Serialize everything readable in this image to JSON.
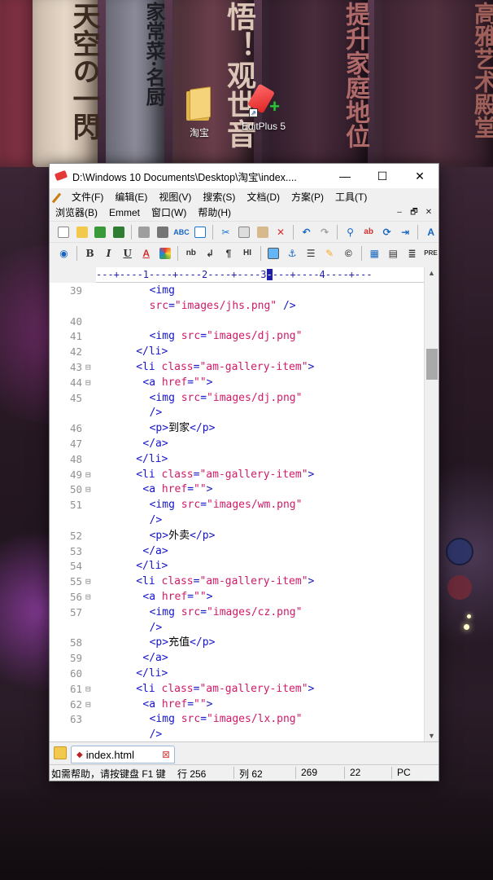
{
  "desktop": {
    "book_titles": [
      "天空の一閃",
      "家常菜·名厨",
      "悟！观世音",
      "提升家庭地位",
      "高雅艺术殿堂"
    ],
    "icons": [
      {
        "label": "淘宝",
        "icon": "folder-icon"
      },
      {
        "label": "EditPlus 5",
        "icon": "editplus-icon"
      }
    ]
  },
  "window": {
    "title": "D:\\Windows 10 Documents\\Desktop\\淘宝\\index....",
    "controls": {
      "minimize": "—",
      "maximize": "☐",
      "close": "✕"
    },
    "menu_row1": [
      "文件(F)",
      "编辑(E)",
      "视图(V)",
      "搜索(S)",
      "文档(D)",
      "方案(P)",
      "工具(T)"
    ],
    "menu_row2": [
      "浏览器(B)",
      "Emmet",
      "窗口(W)",
      "帮助(H)"
    ],
    "mdi_controls": [
      "–",
      "🗗",
      "✕"
    ],
    "ruler": "---+----1----+----2----+----3",
    "ruler_cursor": "-",
    "ruler_rest": "---+----4----+---"
  },
  "code_lines": [
    {
      "n": "39",
      "fold": "",
      "indent": 16,
      "parts": [
        [
          "tag",
          "<img"
        ]
      ]
    },
    {
      "n": "",
      "fold": "",
      "indent": 16,
      "parts": [
        [
          "attr",
          "src"
        ],
        [
          "tag",
          "="
        ],
        [
          "str",
          "\"images/jhs.png\""
        ],
        [
          "tag",
          " />"
        ]
      ]
    },
    {
      "n": "40",
      "fold": "",
      "indent": 0,
      "parts": []
    },
    {
      "n": "41",
      "fold": "",
      "indent": 16,
      "parts": [
        [
          "tag",
          "<img "
        ],
        [
          "attr",
          "src"
        ],
        [
          "tag",
          "="
        ],
        [
          "str",
          "\"images/dj.png\""
        ]
      ]
    },
    {
      "n": "42",
      "fold": "",
      "indent": 12,
      "parts": [
        [
          "tag",
          "</li>"
        ]
      ]
    },
    {
      "n": "43",
      "fold": "⊟",
      "indent": 12,
      "parts": [
        [
          "tag",
          "<li "
        ],
        [
          "attr",
          "class"
        ],
        [
          "tag",
          "="
        ],
        [
          "str",
          "\"am-gallery-item\""
        ],
        [
          "tag",
          ">"
        ]
      ]
    },
    {
      "n": "44",
      "fold": "⊟",
      "indent": 14,
      "parts": [
        [
          "tag",
          "<a "
        ],
        [
          "attr",
          "href"
        ],
        [
          "tag",
          "="
        ],
        [
          "str",
          "\"\""
        ],
        [
          "tag",
          ">"
        ]
      ]
    },
    {
      "n": "45",
      "fold": "",
      "indent": 16,
      "parts": [
        [
          "tag",
          "<img "
        ],
        [
          "attr",
          "src"
        ],
        [
          "tag",
          "="
        ],
        [
          "str",
          "\"images/dj.png\""
        ]
      ]
    },
    {
      "n": "",
      "fold": "",
      "indent": 16,
      "parts": [
        [
          "tag",
          "/>"
        ]
      ]
    },
    {
      "n": "46",
      "fold": "",
      "indent": 16,
      "parts": [
        [
          "tag",
          "<p>"
        ],
        [
          "txt",
          "到家"
        ],
        [
          "tag",
          "</p>"
        ]
      ]
    },
    {
      "n": "47",
      "fold": "",
      "indent": 14,
      "parts": [
        [
          "tag",
          "</a>"
        ]
      ]
    },
    {
      "n": "48",
      "fold": "",
      "indent": 12,
      "parts": [
        [
          "tag",
          "</li>"
        ]
      ]
    },
    {
      "n": "49",
      "fold": "⊟",
      "indent": 12,
      "parts": [
        [
          "tag",
          "<li "
        ],
        [
          "attr",
          "class"
        ],
        [
          "tag",
          "="
        ],
        [
          "str",
          "\"am-gallery-item\""
        ],
        [
          "tag",
          ">"
        ]
      ]
    },
    {
      "n": "50",
      "fold": "⊟",
      "indent": 14,
      "parts": [
        [
          "tag",
          "<a "
        ],
        [
          "attr",
          "href"
        ],
        [
          "tag",
          "="
        ],
        [
          "str",
          "\"\""
        ],
        [
          "tag",
          ">"
        ]
      ]
    },
    {
      "n": "51",
      "fold": "",
      "indent": 16,
      "parts": [
        [
          "tag",
          "<img "
        ],
        [
          "attr",
          "src"
        ],
        [
          "tag",
          "="
        ],
        [
          "str",
          "\"images/wm.png\""
        ]
      ]
    },
    {
      "n": "",
      "fold": "",
      "indent": 16,
      "parts": [
        [
          "tag",
          "/>"
        ]
      ]
    },
    {
      "n": "52",
      "fold": "",
      "indent": 16,
      "parts": [
        [
          "tag",
          "<p>"
        ],
        [
          "txt",
          "外卖"
        ],
        [
          "tag",
          "</p>"
        ]
      ]
    },
    {
      "n": "53",
      "fold": "",
      "indent": 14,
      "parts": [
        [
          "tag",
          "</a>"
        ]
      ]
    },
    {
      "n": "54",
      "fold": "",
      "indent": 12,
      "parts": [
        [
          "tag",
          "</li>"
        ]
      ]
    },
    {
      "n": "55",
      "fold": "⊟",
      "indent": 12,
      "parts": [
        [
          "tag",
          "<li "
        ],
        [
          "attr",
          "class"
        ],
        [
          "tag",
          "="
        ],
        [
          "str",
          "\"am-gallery-item\""
        ],
        [
          "tag",
          ">"
        ]
      ]
    },
    {
      "n": "56",
      "fold": "⊟",
      "indent": 14,
      "parts": [
        [
          "tag",
          "<a "
        ],
        [
          "attr",
          "href"
        ],
        [
          "tag",
          "="
        ],
        [
          "str",
          "\"\""
        ],
        [
          "tag",
          ">"
        ]
      ]
    },
    {
      "n": "57",
      "fold": "",
      "indent": 16,
      "parts": [
        [
          "tag",
          "<img "
        ],
        [
          "attr",
          "src"
        ],
        [
          "tag",
          "="
        ],
        [
          "str",
          "\"images/cz.png\""
        ]
      ]
    },
    {
      "n": "",
      "fold": "",
      "indent": 16,
      "parts": [
        [
          "tag",
          "/>"
        ]
      ]
    },
    {
      "n": "58",
      "fold": "",
      "indent": 16,
      "parts": [
        [
          "tag",
          "<p>"
        ],
        [
          "txt",
          "充值"
        ],
        [
          "tag",
          "</p>"
        ]
      ]
    },
    {
      "n": "59",
      "fold": "",
      "indent": 14,
      "parts": [
        [
          "tag",
          "</a>"
        ]
      ]
    },
    {
      "n": "60",
      "fold": "",
      "indent": 12,
      "parts": [
        [
          "tag",
          "</li>"
        ]
      ]
    },
    {
      "n": "61",
      "fold": "⊟",
      "indent": 12,
      "parts": [
        [
          "tag",
          "<li "
        ],
        [
          "attr",
          "class"
        ],
        [
          "tag",
          "="
        ],
        [
          "str",
          "\"am-gallery-item\""
        ],
        [
          "tag",
          ">"
        ]
      ]
    },
    {
      "n": "62",
      "fold": "⊟",
      "indent": 14,
      "parts": [
        [
          "tag",
          "<a "
        ],
        [
          "attr",
          "href"
        ],
        [
          "tag",
          "="
        ],
        [
          "str",
          "\"\""
        ],
        [
          "tag",
          ">"
        ]
      ]
    },
    {
      "n": "63",
      "fold": "",
      "indent": 16,
      "parts": [
        [
          "tag",
          "<img "
        ],
        [
          "attr",
          "src"
        ],
        [
          "tag",
          "="
        ],
        [
          "str",
          "\"images/lx.png\""
        ]
      ]
    },
    {
      "n": "",
      "fold": "",
      "indent": 16,
      "parts": [
        [
          "tag",
          "/>"
        ]
      ]
    }
  ],
  "tab": {
    "label": "index.html",
    "modified_mark": "◆",
    "close": "⊠"
  },
  "status": {
    "help": "如需帮助，请按键盘 F1 键",
    "row": "行 256",
    "col": "列 62",
    "num1": "269",
    "num2": "22",
    "mode": "PC"
  }
}
